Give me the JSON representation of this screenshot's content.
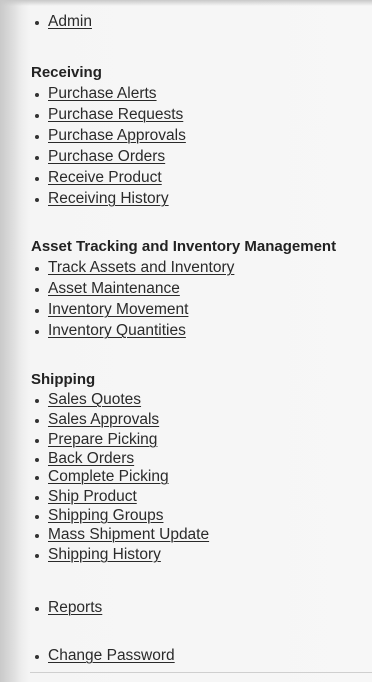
{
  "admin_item": "Admin",
  "receiving": {
    "heading": "Receiving",
    "items": [
      "Purchase Alerts",
      "Purchase Requests",
      "Purchase Approvals",
      "Purchase Orders",
      "Receive Product",
      "Receiving History"
    ]
  },
  "asset_tracking": {
    "heading": "Asset Tracking and Inventory Management",
    "items": [
      "Track Assets and Inventory",
      "Asset Maintenance",
      "Inventory Movement",
      "Inventory Quantities"
    ]
  },
  "shipping": {
    "heading": "Shipping",
    "items": [
      "Sales Quotes",
      "Sales Approvals",
      "Prepare Picking",
      "Back Orders",
      "Complete Picking",
      "Ship Product",
      "Shipping Groups",
      "Mass Shipment Update",
      "Shipping History"
    ]
  },
  "reports_item": "Reports",
  "change_password_item": "Change Password"
}
